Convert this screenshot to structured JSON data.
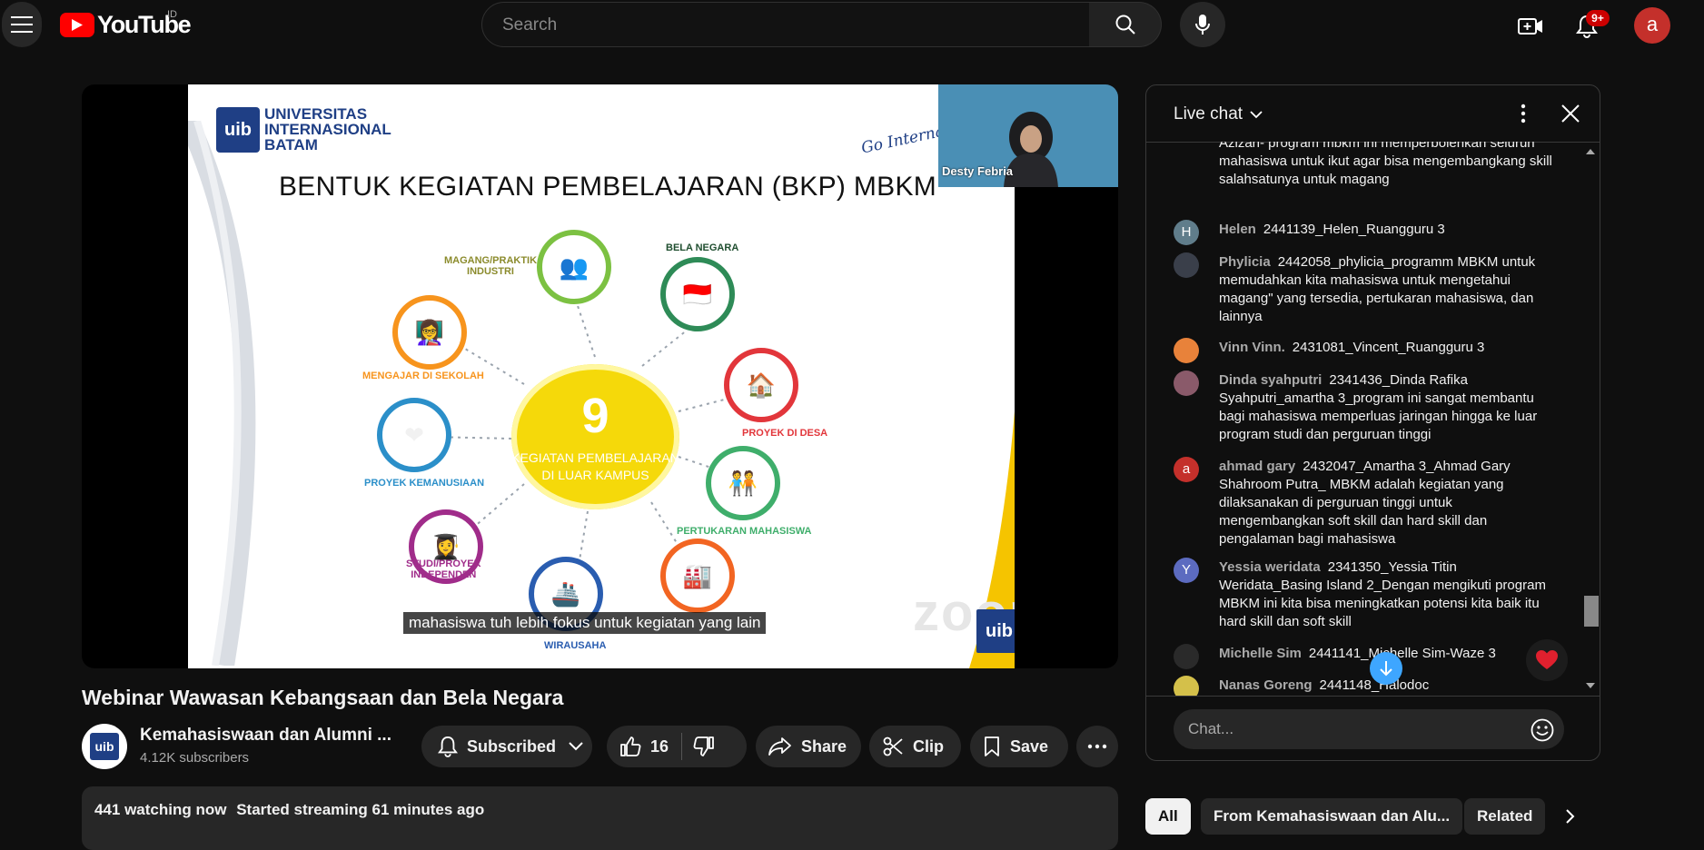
{
  "header": {
    "logo_text": "YouTube",
    "country_code": "ID",
    "search_placeholder": "Search",
    "notification_badge": "9+",
    "avatar_letter": "a"
  },
  "player": {
    "slide": {
      "university_line1": "UNIVERSITAS",
      "university_line2": "INTERNASIONAL",
      "university_line3": "BATAM",
      "uib_logo": "uib",
      "tagline": "Go International",
      "title": "BENTUK KEGIATAN PEMBELAJARAN (BKP)  MBKM",
      "hub_number": "9",
      "hub_line1": "KEGIATAN PEMBELAJARAN",
      "hub_line2": "DI LUAR KAMPUS",
      "nodes": [
        {
          "label": "MAGANG/PRAKTIK",
          "label2": "INDUSTRI",
          "color": "#7cc142"
        },
        {
          "label": "BELA NEGARA",
          "label2": "",
          "color": "#2e8b57"
        },
        {
          "label": "PROYEK DI DESA",
          "label2": "",
          "color": "#e2363b"
        },
        {
          "label": "PERTUKARAN MAHASISWA",
          "label2": "",
          "color": "#3fae6b"
        },
        {
          "label": "",
          "label2": "",
          "color": "#f26522"
        },
        {
          "label": "WIRAUSAHA",
          "label2": "",
          "color": "#2a5db0"
        },
        {
          "label": "STUDI/PROYEK",
          "label2": "INDEPENDEN",
          "color": "#a02c8a"
        },
        {
          "label": "PROYEK KEMANUSIAAN",
          "label2": "",
          "color": "#2b8fc9"
        },
        {
          "label": "MENGAJAR DI SEKOLAH",
          "label2": "",
          "color": "#f7941d"
        }
      ],
      "watermark": "zoom",
      "corner_logo": "uib"
    },
    "participant_name": "Desty Febria",
    "caption": "mahasiswa tuh lebih fokus untuk kegiatan yang lain"
  },
  "video": {
    "title": "Webinar Wawasan Kebangsaan dan Bela Negara",
    "channel_name": "Kemahasiswaan dan Alumni ...",
    "channel_avatar": "uib",
    "subscribers": "4.12K subscribers",
    "subscribe_label": "Subscribed",
    "like_count": "16",
    "share_label": "Share",
    "clip_label": "Clip",
    "save_label": "Save",
    "watching": "441 watching now",
    "started": "Started streaming 61 minutes ago"
  },
  "chat": {
    "title": "Live chat",
    "input_placeholder": "Chat...",
    "messages": [
      {
        "author": "",
        "text": "Azizah- program mbkm ini memperbolehkan seluruh mahasiswa untuk ikut agar bisa mengembangkang skill salahsatunya untuk magang",
        "avatar": "",
        "color": "#0f0f0f"
      },
      {
        "author": "Helen",
        "text": "2441139_Helen_Ruangguru 3",
        "avatar": "H",
        "color": "#607d8b"
      },
      {
        "author": "Phylicia",
        "text": "2442058_phylicia_programm MBKM untuk memudahkan kita mahasiswa untuk mengetahui magang\" yang tersedia, pertukaran mahasiswa, dan lainnya",
        "avatar": "",
        "color": "#3a3f4a"
      },
      {
        "author": "Vinn Vinn.",
        "text": "2431081_Vincent_Ruangguru 3",
        "avatar": "",
        "color": "#e8823a"
      },
      {
        "author": "Dinda syahputri",
        "text": "2341436_Dinda Rafika Syahputri_amartha 3_program ini sangat membantu bagi mahasiswa memperluas jaringan hingga ke luar program studi dan perguruan tinggi",
        "avatar": "",
        "color": "#8a5a6a"
      },
      {
        "author": "ahmad gary",
        "text": "2432047_Amartha 3_Ahmad Gary Shahroom Putra_ MBKM adalah kegiatan yang dilaksanakan di perguruan tinggi untuk mengembangkan soft skill dan hard skill dan pengalaman bagi mahasiswa",
        "avatar": "a",
        "color": "#c4302b"
      },
      {
        "author": "Yessia weridata",
        "text": "2341350_Yessia Titin Weridata_Basing Island 2_Dengan mengikuti program MBKM ini kita bisa meningkatkan potensi kita baik itu hard skill dan soft skill",
        "avatar": "Y",
        "color": "#5c6bc0"
      },
      {
        "author": "Michelle Sim",
        "text": "2441141_Michelle Sim-Waze 3",
        "avatar": "",
        "color": "#2a2a2a"
      },
      {
        "author": "Nanas Goreng",
        "text": "2441148_Halodoc",
        "avatar": "",
        "color": "#d4c04a"
      }
    ]
  },
  "chips": {
    "all": "All",
    "from": "From Kemahasiswaan dan Alu...",
    "related": "Related"
  },
  "colors": {
    "background": "#0f0f0f",
    "brand_red": "#ff0000",
    "surface": "#272727",
    "accent_blue": "#3ea6ff"
  }
}
